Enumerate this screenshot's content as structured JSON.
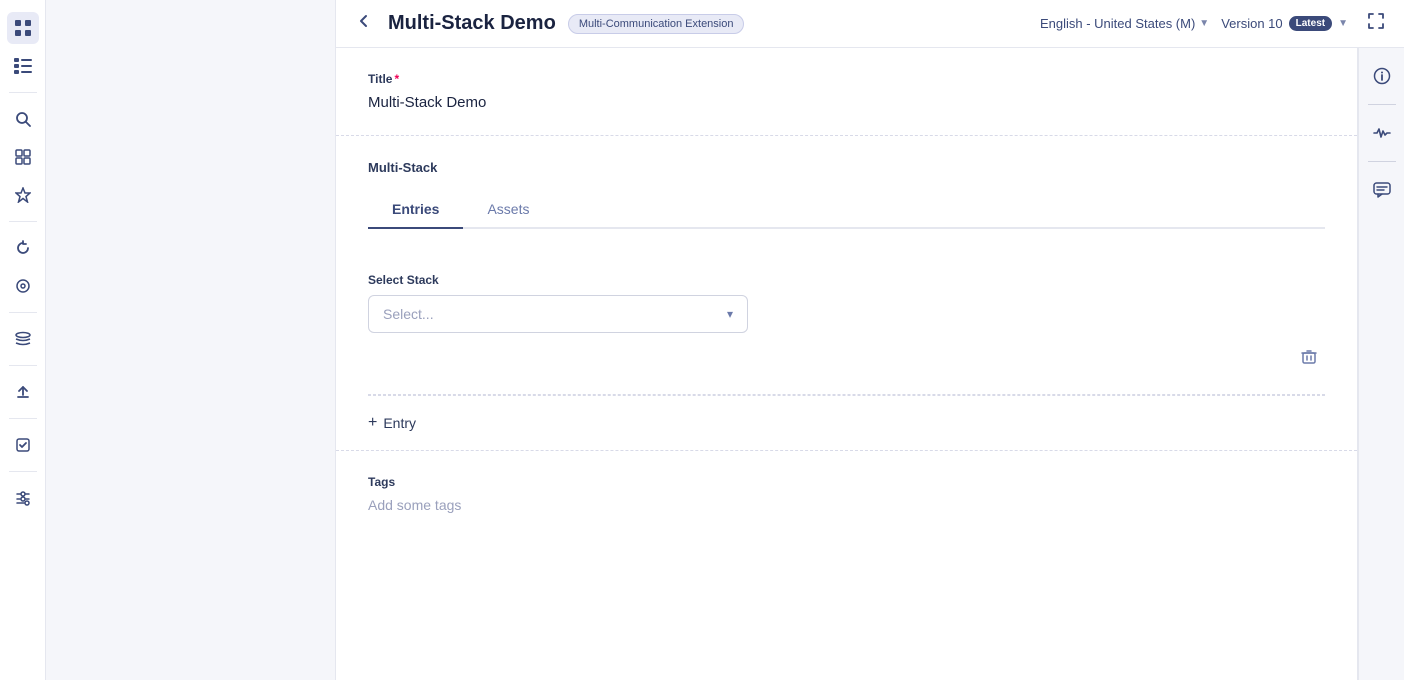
{
  "header": {
    "back_icon": "←",
    "title": "Multi-Stack Demo",
    "badge": "Multi-Communication Extension",
    "language": "English - United States (M)",
    "version_label": "Version 10",
    "version_badge": "Latest",
    "expand_icon": "⛶"
  },
  "icon_rail": {
    "icons": [
      {
        "name": "grid-icon",
        "symbol": "⊞",
        "active": true
      },
      {
        "name": "list-icon",
        "symbol": "☰"
      },
      {
        "name": "search-icon",
        "symbol": "🔍"
      },
      {
        "name": "bookmark-icon",
        "symbol": "⊞"
      },
      {
        "name": "star-icon",
        "symbol": "☆"
      },
      {
        "name": "refresh-icon",
        "symbol": "↻"
      },
      {
        "name": "tag-icon",
        "symbol": "⊛"
      },
      {
        "name": "layers-icon",
        "symbol": "⊟"
      },
      {
        "name": "upload-icon",
        "symbol": "↑"
      },
      {
        "name": "tasks-icon",
        "symbol": "☑"
      },
      {
        "name": "settings-icon",
        "symbol": "⚙"
      }
    ]
  },
  "right_panel": {
    "icons": [
      {
        "name": "info-icon",
        "symbol": "ℹ"
      },
      {
        "name": "activity-icon",
        "symbol": "∿"
      },
      {
        "name": "chat-icon",
        "symbol": "💬"
      }
    ]
  },
  "form": {
    "title_label": "Title",
    "title_required": "*",
    "title_value": "Multi-Stack Demo",
    "multistack_label": "Multi-Stack",
    "tabs": [
      {
        "id": "entries",
        "label": "Entries",
        "active": true
      },
      {
        "id": "assets",
        "label": "Assets",
        "active": false
      }
    ],
    "select_stack": {
      "label": "Select Stack",
      "placeholder": "Select..."
    },
    "add_entry_label": "+ Entry",
    "tags_label": "Tags",
    "tags_placeholder": "Add some tags"
  }
}
